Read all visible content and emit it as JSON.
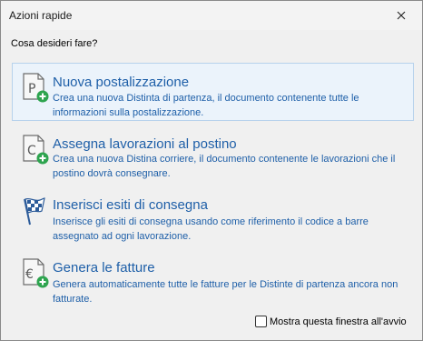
{
  "window": {
    "title": "Azioni rapide"
  },
  "prompt": "Cosa desideri fare?",
  "actions": [
    {
      "title": "Nuova postalizzazione",
      "description": "Crea una nuova Distinta di partenza, il documento contenente tutte le informazioni sulla postalizzazione.",
      "icon": "document-p-add-icon"
    },
    {
      "title": "Assegna lavorazioni al postino",
      "description": "Crea una nuova Distina corriere, il documento contenente le lavorazioni che il postino dovrà consegnare.",
      "icon": "document-c-add-icon"
    },
    {
      "title": "Inserisci esiti di consegna",
      "description": "Inserisce gli esiti di consegna usando come riferimento il codice a barre assegnato ad ogni lavorazione.",
      "icon": "checkered-flag-icon"
    },
    {
      "title": "Genera le fatture",
      "description": "Genera automaticamente tutte le fatture per le Distinte di partenza ancora non fatturate.",
      "icon": "euro-document-add-icon"
    }
  ],
  "startup_checkbox": {
    "label": "Mostra questa finestra all'avvio",
    "checked": false
  },
  "colors": {
    "link_blue": "#1e5fa8",
    "selected_bg": "#ebf3fb",
    "selected_border": "#b7d2ec",
    "add_badge_green": "#2ea44f"
  }
}
